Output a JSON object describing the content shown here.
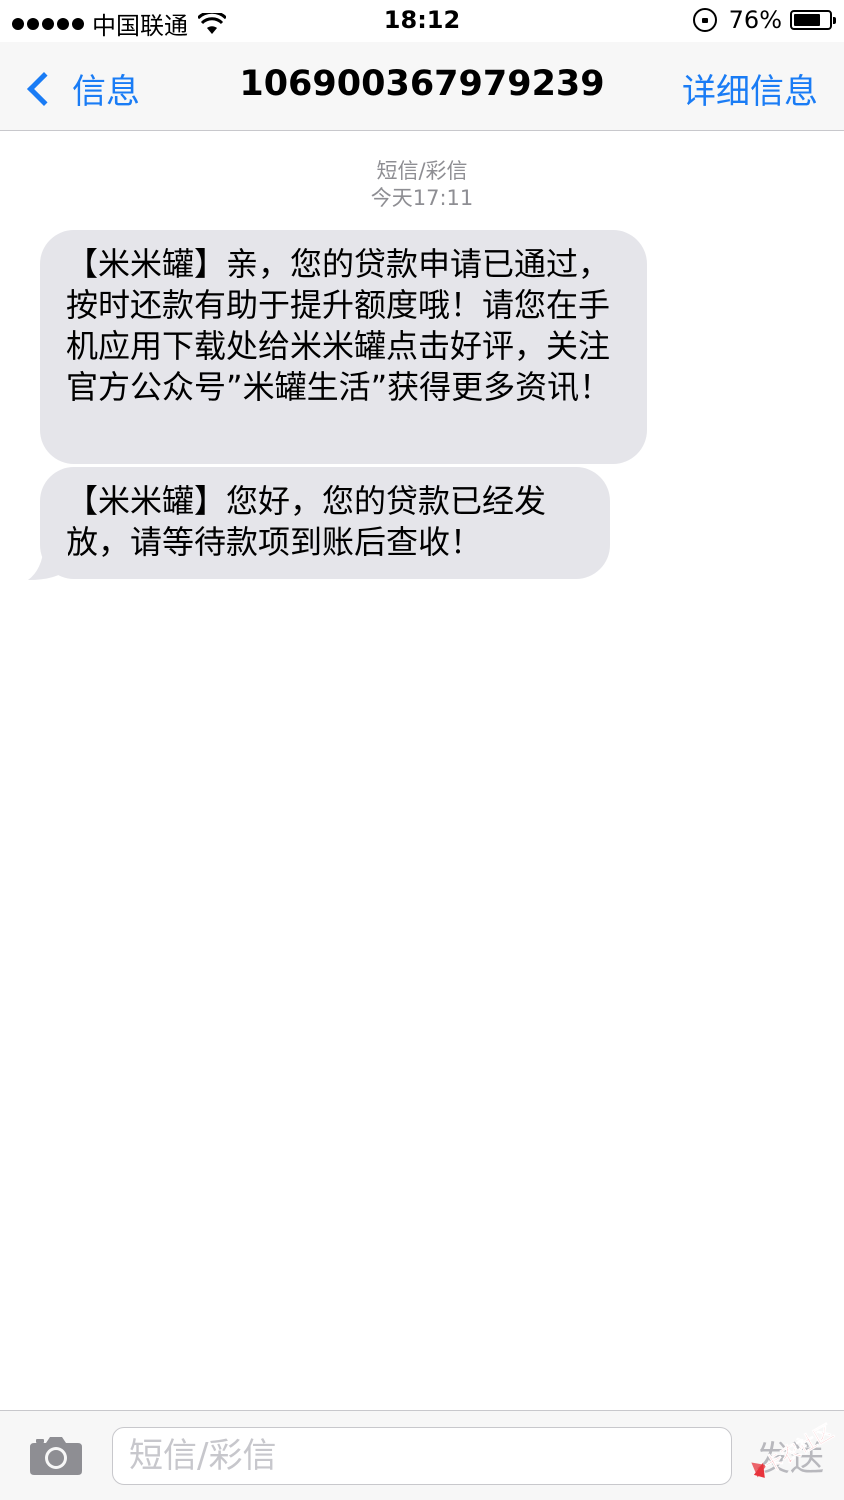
{
  "status_bar": {
    "carrier": "中国联通",
    "time": "18:12",
    "battery_percent": "76%",
    "battery_level": 0.76
  },
  "nav": {
    "back_label": "信息",
    "title": "106900367979239",
    "details_label": "详细信息"
  },
  "conversation": {
    "type_label": "短信/彩信",
    "timestamp": "今天17:11",
    "messages": [
      {
        "text": "【米米罐】亲，您的贷款申请已通过，按时还款有助于提升额度哦！请您在手机应用下载处给米米罐点击好评，关注官方公众号”米罐生活”获得更多资讯！"
      },
      {
        "text": "【米米罐】您好，您的贷款已经发放，请等待款项到账后查收！"
      }
    ]
  },
  "input": {
    "placeholder": "短信/彩信",
    "send_label": "发送"
  },
  "watermark": {
    "logo_text": "卡农社区"
  },
  "colors": {
    "accent": "#1a7cf5",
    "bubble": "#e5e5ea",
    "meta_text": "#8e8e93"
  }
}
